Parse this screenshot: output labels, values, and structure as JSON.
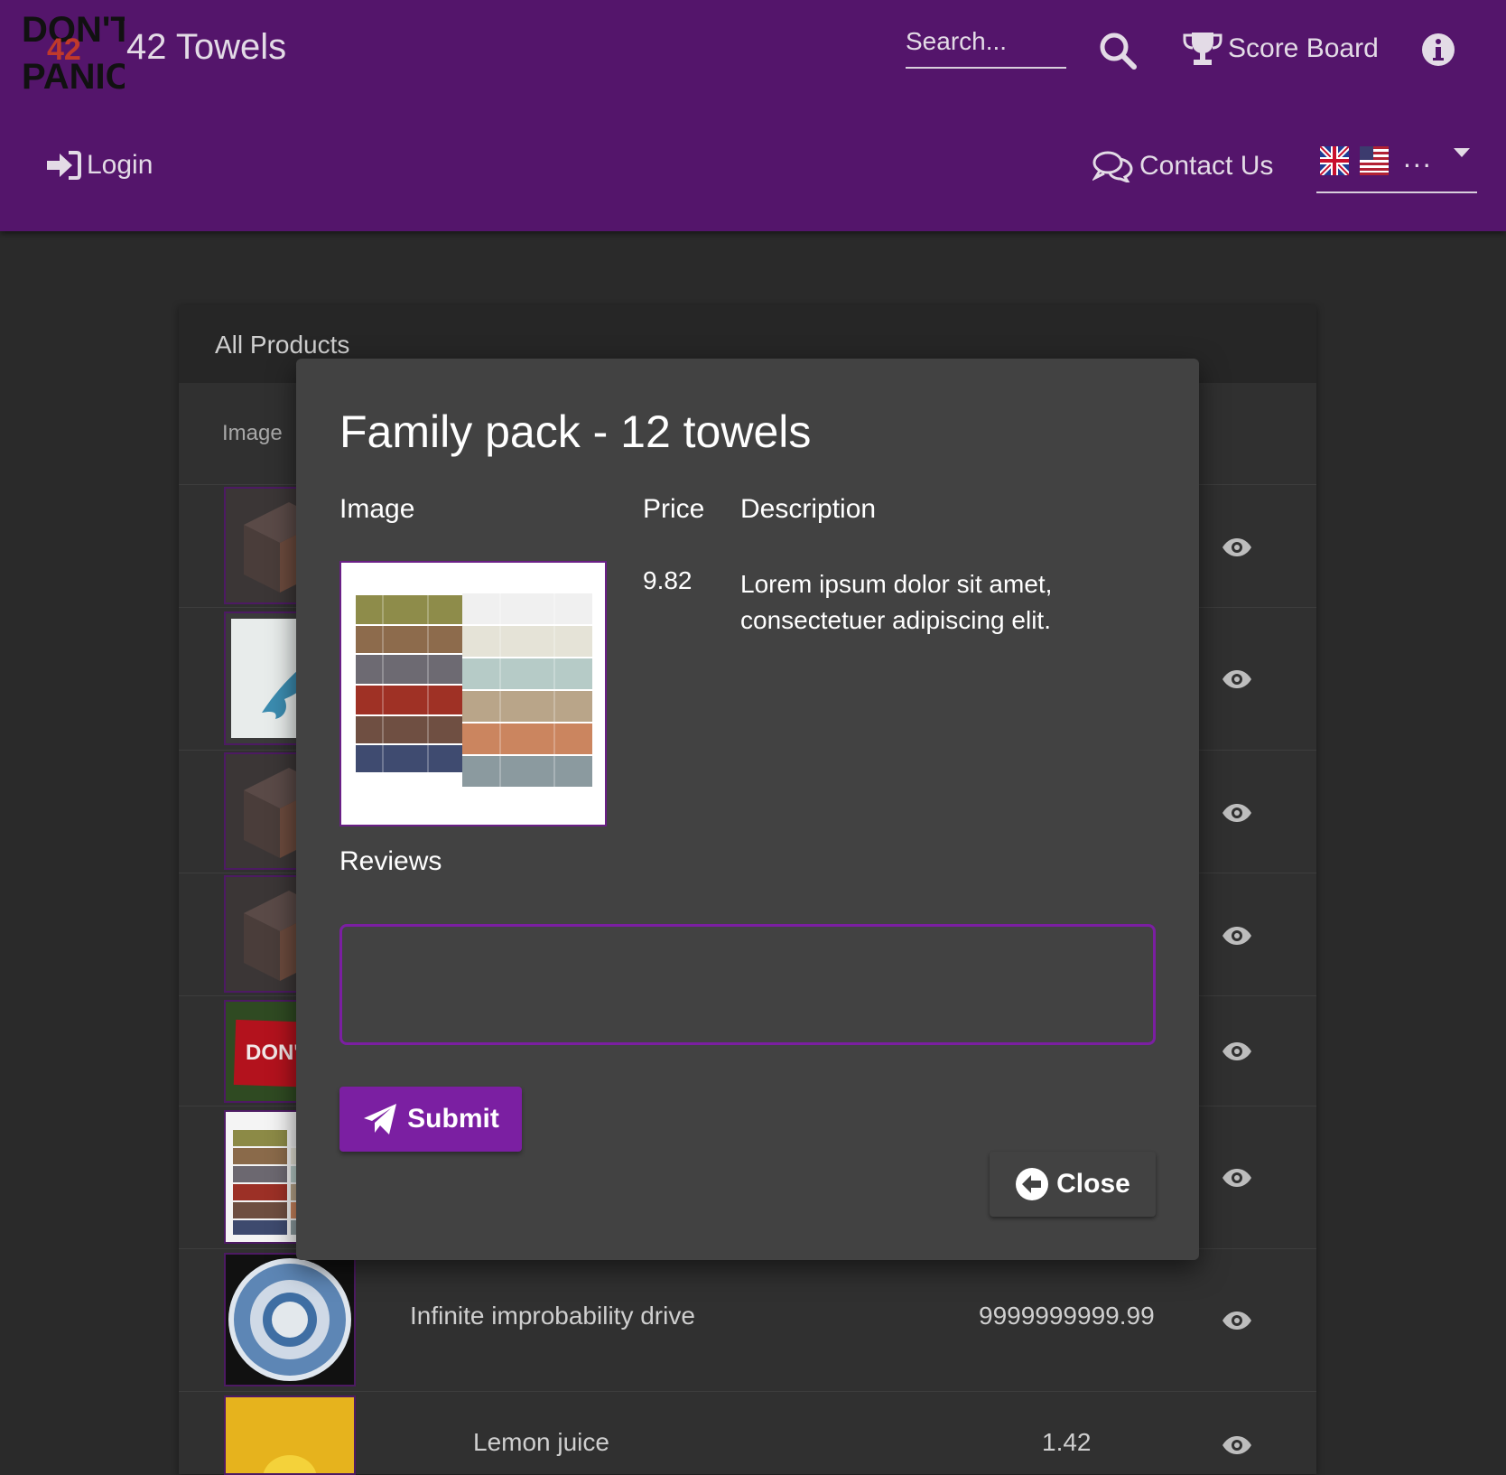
{
  "header": {
    "app_name": "42 Towels",
    "logo_text_top": "DON'T",
    "logo_text_mid": "42",
    "logo_text_bottom": "PANIC",
    "search_placeholder": "Search...",
    "score_board_label": "Score Board",
    "login_label": "Login",
    "contact_label": "Contact Us",
    "language_more": "...",
    "brand_color": "#54156b"
  },
  "products_card": {
    "title": "All Products",
    "image_column": "Image",
    "rows": [
      {
        "thumb": "box",
        "name": "",
        "price": ""
      },
      {
        "thumb": "dolphin",
        "name": "",
        "price": ""
      },
      {
        "thumb": "box",
        "name": "",
        "price": ""
      },
      {
        "thumb": "box",
        "name": "",
        "price": ""
      },
      {
        "thumb": "dont-towel",
        "thumb_text": "DON'T",
        "name": "",
        "price": ""
      },
      {
        "thumb": "towel-stack",
        "name": "",
        "price": ""
      },
      {
        "thumb": "plate",
        "name": "Infinite improbability drive",
        "price": "9999999999.99"
      },
      {
        "thumb": "lemon",
        "name": "Lemon juice",
        "price": "1.42"
      }
    ]
  },
  "dialog": {
    "title": "Family pack - 12 towels",
    "image_label": "Image",
    "price_label": "Price",
    "description_label": "Description",
    "price": "9.82",
    "description": "Lorem ipsum dolor sit amet, consectetuer adipiscing elit.",
    "reviews_label": "Reviews",
    "review_value": "",
    "submit_label": "Submit",
    "close_label": "Close",
    "accent_color": "#7b1fa2"
  }
}
